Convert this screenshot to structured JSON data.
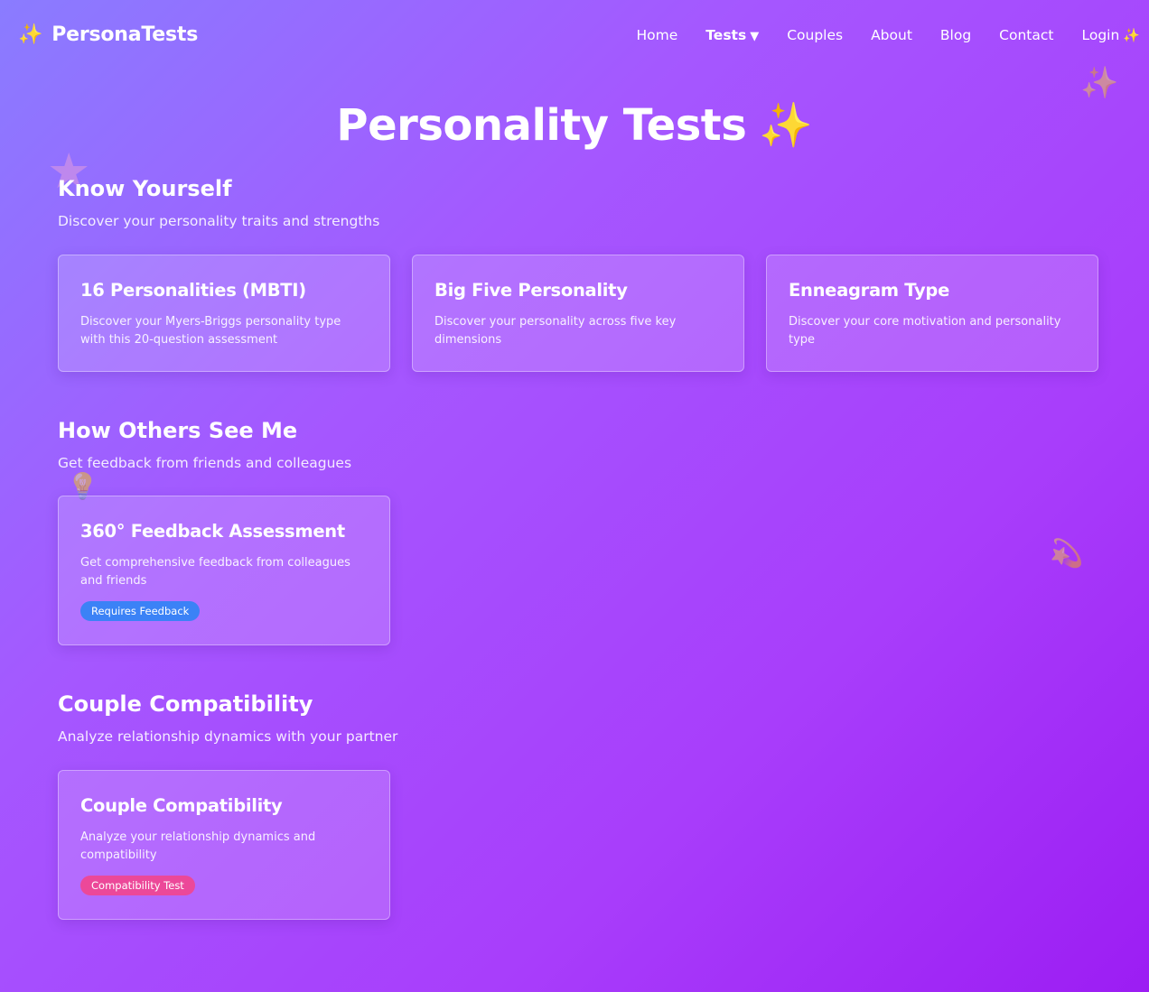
{
  "nav": {
    "brand_icon": "✨",
    "brand": "PersonaTests",
    "home": "Home",
    "tests": "Tests",
    "tests_caret": "▼",
    "couples": "Couples",
    "about": "About",
    "blog": "Blog",
    "contact": "Contact",
    "login": "Login",
    "login_icon": "✨"
  },
  "page": {
    "title": "Personality Tests",
    "title_icon": "✨"
  },
  "sections": [
    {
      "title": "Know Yourself",
      "subtitle": "Discover your personality traits and strengths",
      "cards": [
        {
          "title": "16 Personalities (MBTI)",
          "description": "Discover your Myers-Briggs personality type with this 20-question assessment"
        },
        {
          "title": "Big Five Personality",
          "description": "Discover your personality across five key dimensions"
        },
        {
          "title": "Enneagram Type",
          "description": "Discover your core motivation and personality type"
        }
      ]
    },
    {
      "title": "How Others See Me",
      "subtitle": "Get feedback from friends and colleagues",
      "cards": [
        {
          "title": "360° Feedback Assessment",
          "description": "Get comprehensive feedback from colleagues and friends",
          "badge": "Requires Feedback"
        }
      ]
    },
    {
      "title": "Couple Compatibility",
      "subtitle": "Analyze relationship dynamics with your partner",
      "cards": [
        {
          "title": "Couple Compatibility",
          "description": "Analyze your relationship dynamics and compatibility",
          "badge": "Compatibility Test"
        }
      ]
    }
  ],
  "decorations": {
    "sparkles": "✨",
    "star": "★",
    "bulb": "💡",
    "comet": "💫"
  },
  "colors": {
    "accent_gold": "#ffc93c",
    "badge_blue": "#3b82f6",
    "badge_pink": "#ec4899"
  }
}
